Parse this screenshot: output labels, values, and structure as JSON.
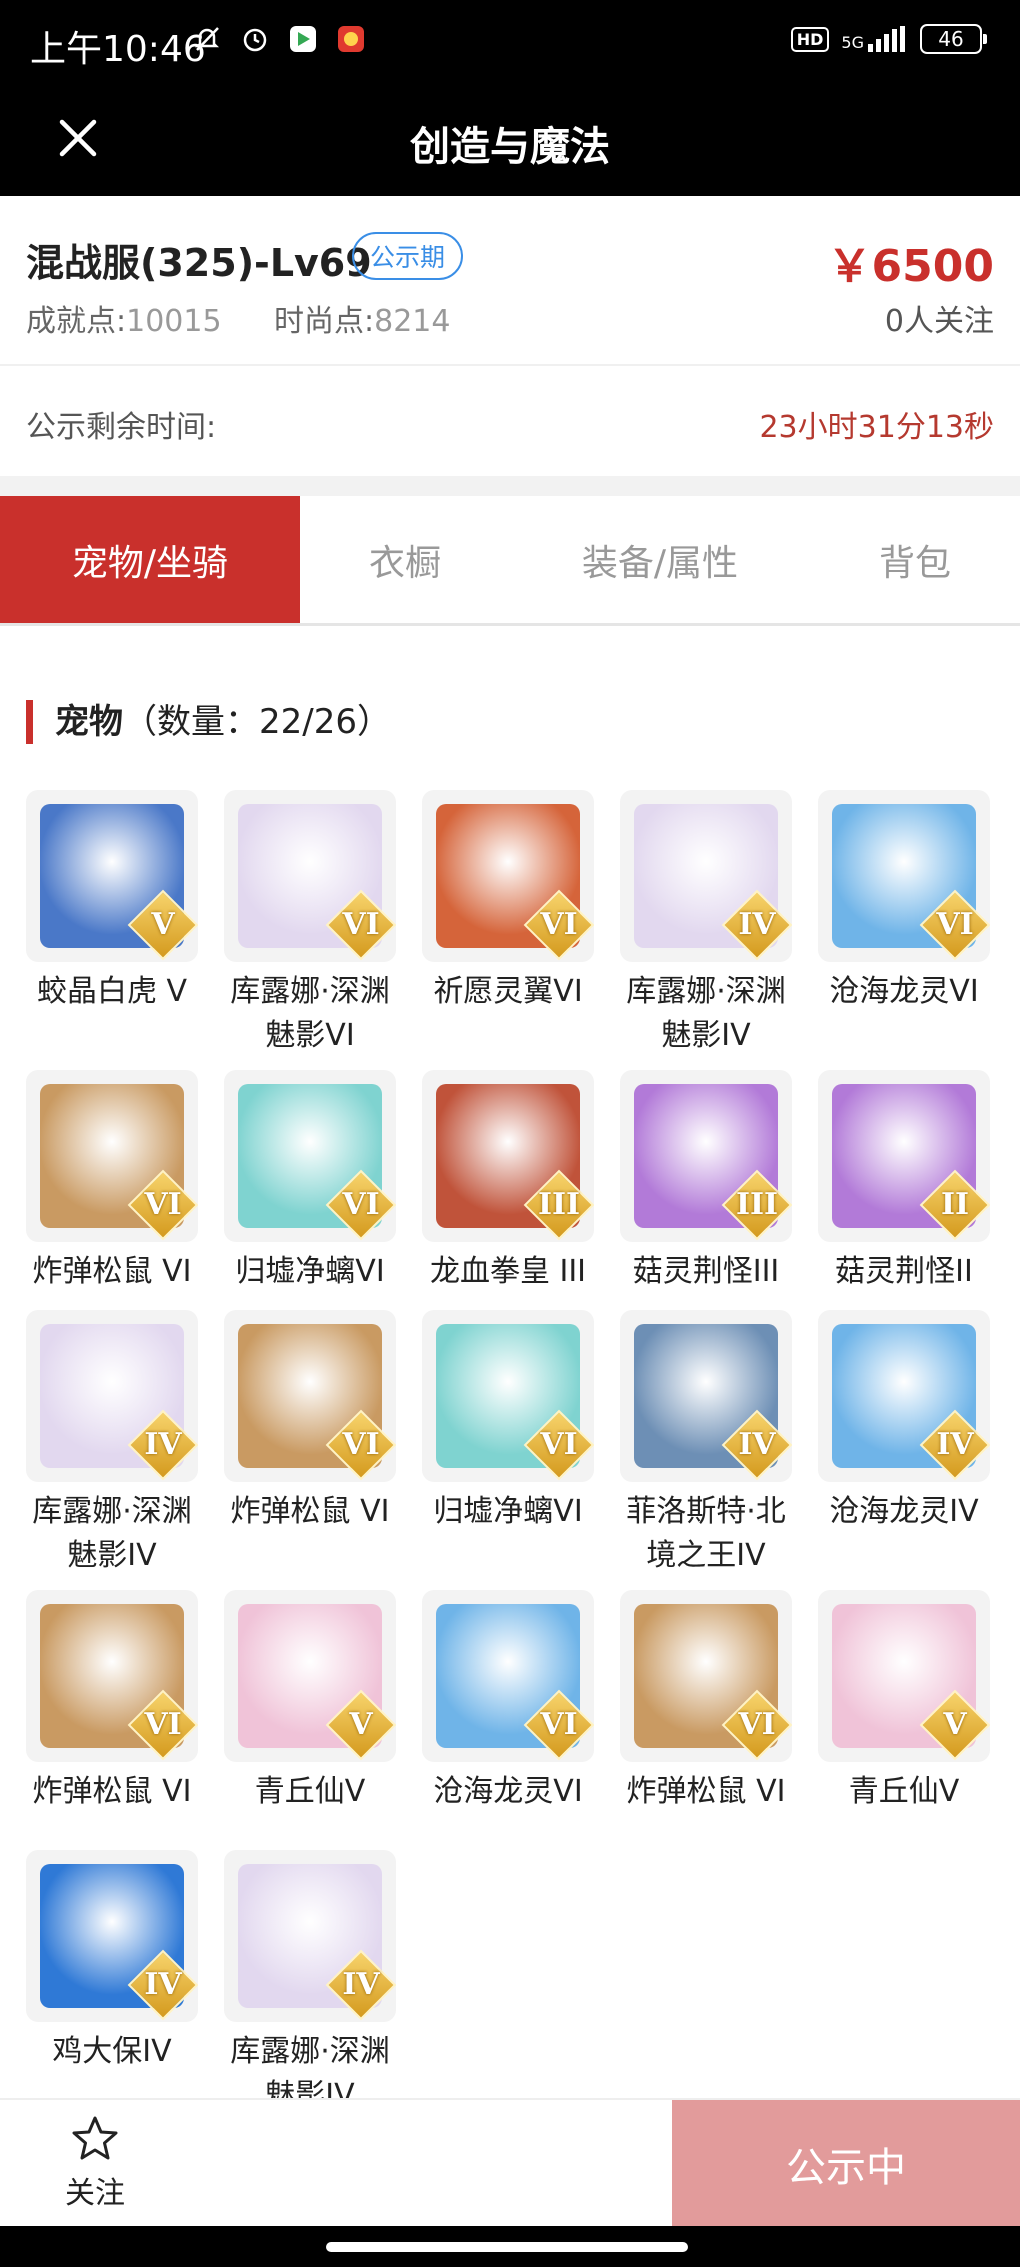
{
  "status_bar": {
    "time": "上午10:46",
    "network": "5G",
    "hd": "HD",
    "battery": "46"
  },
  "nav": {
    "title": "创造与魔法",
    "close_icon": "close-icon"
  },
  "listing": {
    "server_level": "混战服(325)-Lv69",
    "phase_badge": "公示期",
    "price": "￥6500",
    "achievement_label": "成就点:",
    "achievement_value": "10015",
    "fashion_label": "时尚点:",
    "fashion_value": "8214",
    "followers": "0人关注",
    "remaining_label": "公示剩余时间:",
    "remaining_value": "23小时31分13秒"
  },
  "tabs": [
    {
      "label": "宠物/坐骑",
      "active": true
    },
    {
      "label": "衣橱",
      "active": false
    },
    {
      "label": "装备/属性",
      "active": false
    },
    {
      "label": "背包",
      "active": false
    }
  ],
  "section": {
    "title": "宠物",
    "count": "（数量：22/26）"
  },
  "pets": [
    {
      "name": "蛟晶白虎 V",
      "rank": "V",
      "color": "#4a78c8"
    },
    {
      "name": "库露娜·深渊魅影VI",
      "rank": "VI",
      "color": "#e2d8ef"
    },
    {
      "name": "祈愿灵翼VI",
      "rank": "VI",
      "color": "#d5643a"
    },
    {
      "name": "库露娜·深渊魅影IV",
      "rank": "IV",
      "color": "#e2d8ef"
    },
    {
      "name": "沧海龙灵VI",
      "rank": "VI",
      "color": "#6fb4e8"
    },
    {
      "name": "炸弹松鼠 VI",
      "rank": "VI",
      "color": "#c99a62"
    },
    {
      "name": "归墟净螭VI",
      "rank": "VI",
      "color": "#7fd3d0"
    },
    {
      "name": "龙血拳皇 III",
      "rank": "III",
      "color": "#c0533a"
    },
    {
      "name": "菇灵荆怪III",
      "rank": "III",
      "color": "#b27ad8"
    },
    {
      "name": "菇灵荆怪II",
      "rank": "II",
      "color": "#b27ad8"
    },
    {
      "name": "库露娜·深渊魅影IV",
      "rank": "IV",
      "color": "#e2d8ef"
    },
    {
      "name": "炸弹松鼠 VI",
      "rank": "VI",
      "color": "#c99a62"
    },
    {
      "name": "归墟净螭VI",
      "rank": "VI",
      "color": "#7fd3d0"
    },
    {
      "name": "菲洛斯特·北境之王IV",
      "rank": "IV",
      "color": "#6d8fb5"
    },
    {
      "name": "沧海龙灵IV",
      "rank": "IV",
      "color": "#6fb4e8"
    },
    {
      "name": "炸弹松鼠 VI",
      "rank": "VI",
      "color": "#c99a62"
    },
    {
      "name": "青丘仙V",
      "rank": "V",
      "color": "#f0c3d8"
    },
    {
      "name": "沧海龙灵VI",
      "rank": "VI",
      "color": "#6fb4e8"
    },
    {
      "name": "炸弹松鼠 VI",
      "rank": "VI",
      "color": "#c99a62"
    },
    {
      "name": "青丘仙V",
      "rank": "V",
      "color": "#f0c3d8"
    },
    {
      "name": "鸡大保IV",
      "rank": "IV",
      "color": "#2f79d6"
    },
    {
      "name": "库露娜·深渊魅影IV",
      "rank": "IV",
      "color": "#e2d8ef"
    }
  ],
  "bottom": {
    "follow_label": "关注",
    "cta_label": "公示中"
  },
  "colors": {
    "accent": "#c9302c",
    "cta": "#e29b9b",
    "badge": "#3a8ee6"
  }
}
